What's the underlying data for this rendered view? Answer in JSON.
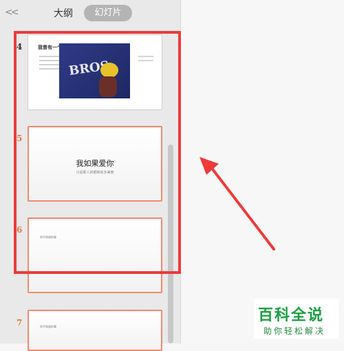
{
  "panel": {
    "collapse_label": "<<",
    "tabs": [
      {
        "label": "大纲",
        "active": false
      },
      {
        "label": "幻灯片",
        "active": true
      }
    ]
  },
  "slides": [
    {
      "number": "4",
      "title": "我曾有一个梦想",
      "image_text": "BROS"
    },
    {
      "number": "5",
      "title": "我如果爱你",
      "subtitle": "只是那人的眼睛有多美丽",
      "selected": true
    },
    {
      "number": "6",
      "bullet": "你不知道的事",
      "selected": true
    },
    {
      "number": "7",
      "bullet": "你不知道的事",
      "selected": true
    }
  ],
  "watermark": {
    "title": "百科全说",
    "subtitle": "助你轻松解决"
  },
  "colors": {
    "annotation_red": "#ee3a3a",
    "selected_border": "#f08a6e",
    "slide_number_orange": "#e8763f",
    "watermark_green": "#1c9e43"
  }
}
